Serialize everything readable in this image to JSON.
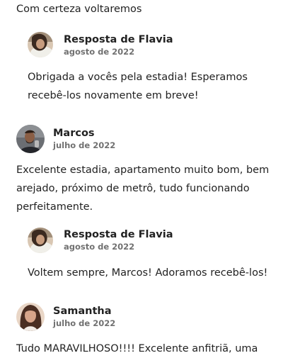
{
  "reviews": [
    {
      "text_lines": [
        "Com certeza voltaremos"
      ],
      "response": {
        "title": "Resposta de Flavia",
        "date": "agosto de 2022",
        "text_lines": [
          "Obrigada a vocês pela estadia! Esperamos",
          "recebê-los novamente em breve!"
        ]
      }
    },
    {
      "author": "Marcos",
      "date": "julho de 2022",
      "text_lines": [
        "Excelente estadia, apartamento muito bom, bem",
        "arejado, próximo de metrô, tudo funcionando",
        "perfeitamente."
      ],
      "response": {
        "title": "Resposta de Flavia",
        "date": "agosto de 2022",
        "text_lines": [
          "Voltem sempre, Marcos! Adoramos recebê-los!"
        ]
      }
    },
    {
      "author": "Samantha",
      "date": "julho de 2022",
      "text_lines": [
        "Tudo MARAVILHOSO!!!! Excelente anfitriã, uma"
      ]
    }
  ]
}
